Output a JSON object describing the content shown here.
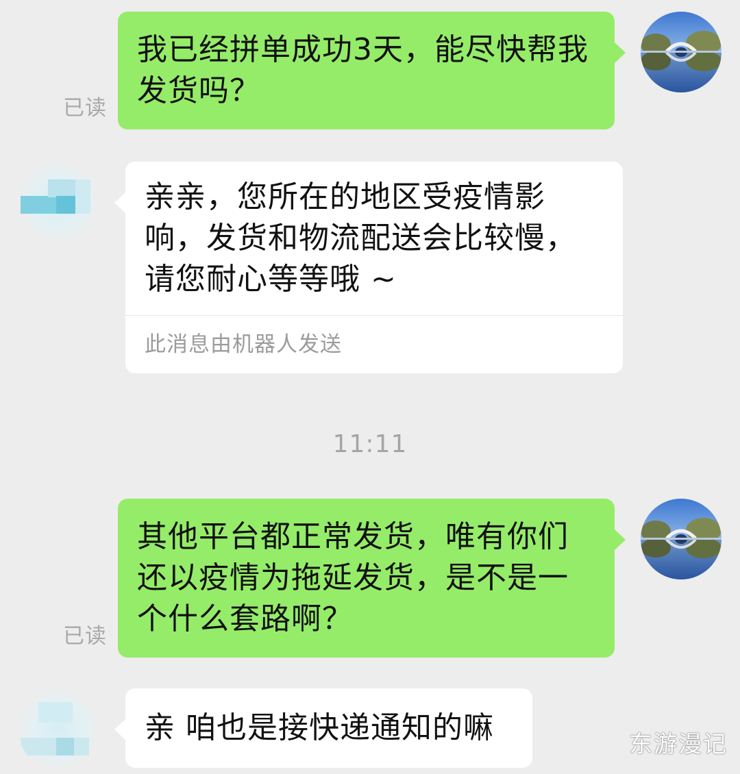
{
  "messages": [
    {
      "sender": "self",
      "text": "我已经拼单成功3天，能尽快帮我发货吗？",
      "status": "已读"
    },
    {
      "sender": "other",
      "text": "亲亲，您所在的地区受疫情影响，发货和物流配送会比较慢，请您耐心等等哦 ~",
      "footnote": "此消息由机器人发送"
    },
    {
      "sender": "self",
      "text": "其他平台都正常发货，唯有你们还以疫情为拖延发货，是不是一个什么套路啊？",
      "status": "已读"
    },
    {
      "sender": "other",
      "text": "亲 咱也是接快递通知的嘛"
    }
  ],
  "timestamp": "11:11",
  "watermark": "东游漫记",
  "colors": {
    "background": "#ededed",
    "self_bubble": "#95ec69",
    "other_bubble": "#ffffff",
    "meta_text": "#a9a9a9"
  },
  "icons": {
    "self_avatar": "lake-bridge-photo-avatar",
    "other_avatar": "blurred-mosaic-avatar"
  }
}
